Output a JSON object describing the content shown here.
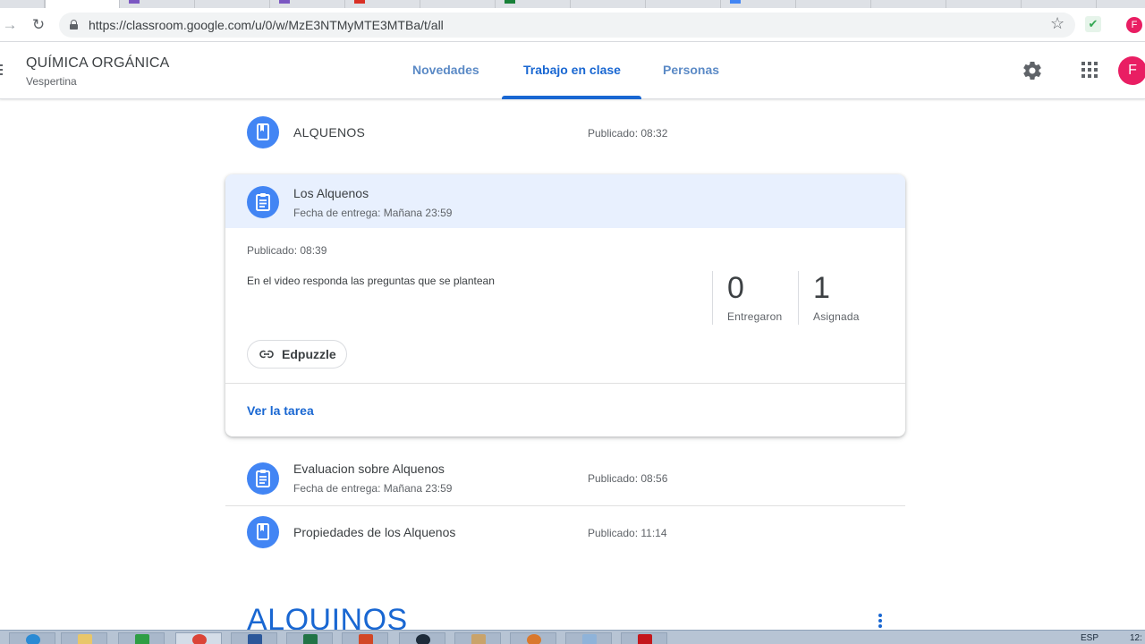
{
  "browser": {
    "url": "https://classroom.google.com/u/0/w/MzE3NTMyMTE3MTBa/t/all",
    "profile_initial": "F"
  },
  "header": {
    "class_name": "QUÍMICA ORGÁNICA",
    "class_section": "Vespertina",
    "tabs": [
      {
        "label": "Novedades",
        "active": false
      },
      {
        "label": "Trabajo en clase",
        "active": true
      },
      {
        "label": "Personas",
        "active": false
      }
    ],
    "avatar_initial": "F"
  },
  "items": {
    "material_1": {
      "title": "ALQUENOS",
      "posted": "Publicado: 08:32",
      "icon": "material-icon"
    },
    "expanded": {
      "title": "Los Alquenos",
      "due": "Fecha de entrega: Mañana 23:59",
      "posted": "Publicado: 08:39",
      "description": "En el video responda las preguntas que se plantean",
      "turned_in_count": "0",
      "turned_in_label": "Entregaron",
      "assigned_count": "1",
      "assigned_label": "Asignada",
      "attachment": "Edpuzzle",
      "view_link": "Ver la tarea",
      "icon": "assignment-icon"
    },
    "assignment_2": {
      "title": "Evaluacion sobre Alquenos",
      "due": "Fecha de entrega: Mañana 23:59",
      "posted": "Publicado: 08:56",
      "icon": "assignment-icon"
    },
    "material_2": {
      "title": "Propiedades de los Alquenos",
      "posted": "Publicado: 11:14",
      "icon": "material-icon"
    }
  },
  "next_topic": {
    "title": "ALQUINOS"
  },
  "taskbar": {
    "language": "ESP",
    "clock": "12:"
  },
  "colors": {
    "accent": "#1967d2",
    "icon_circle": "#4285f4",
    "expanded_header_bg": "#e8f0fe",
    "avatar": "#e91e63"
  }
}
